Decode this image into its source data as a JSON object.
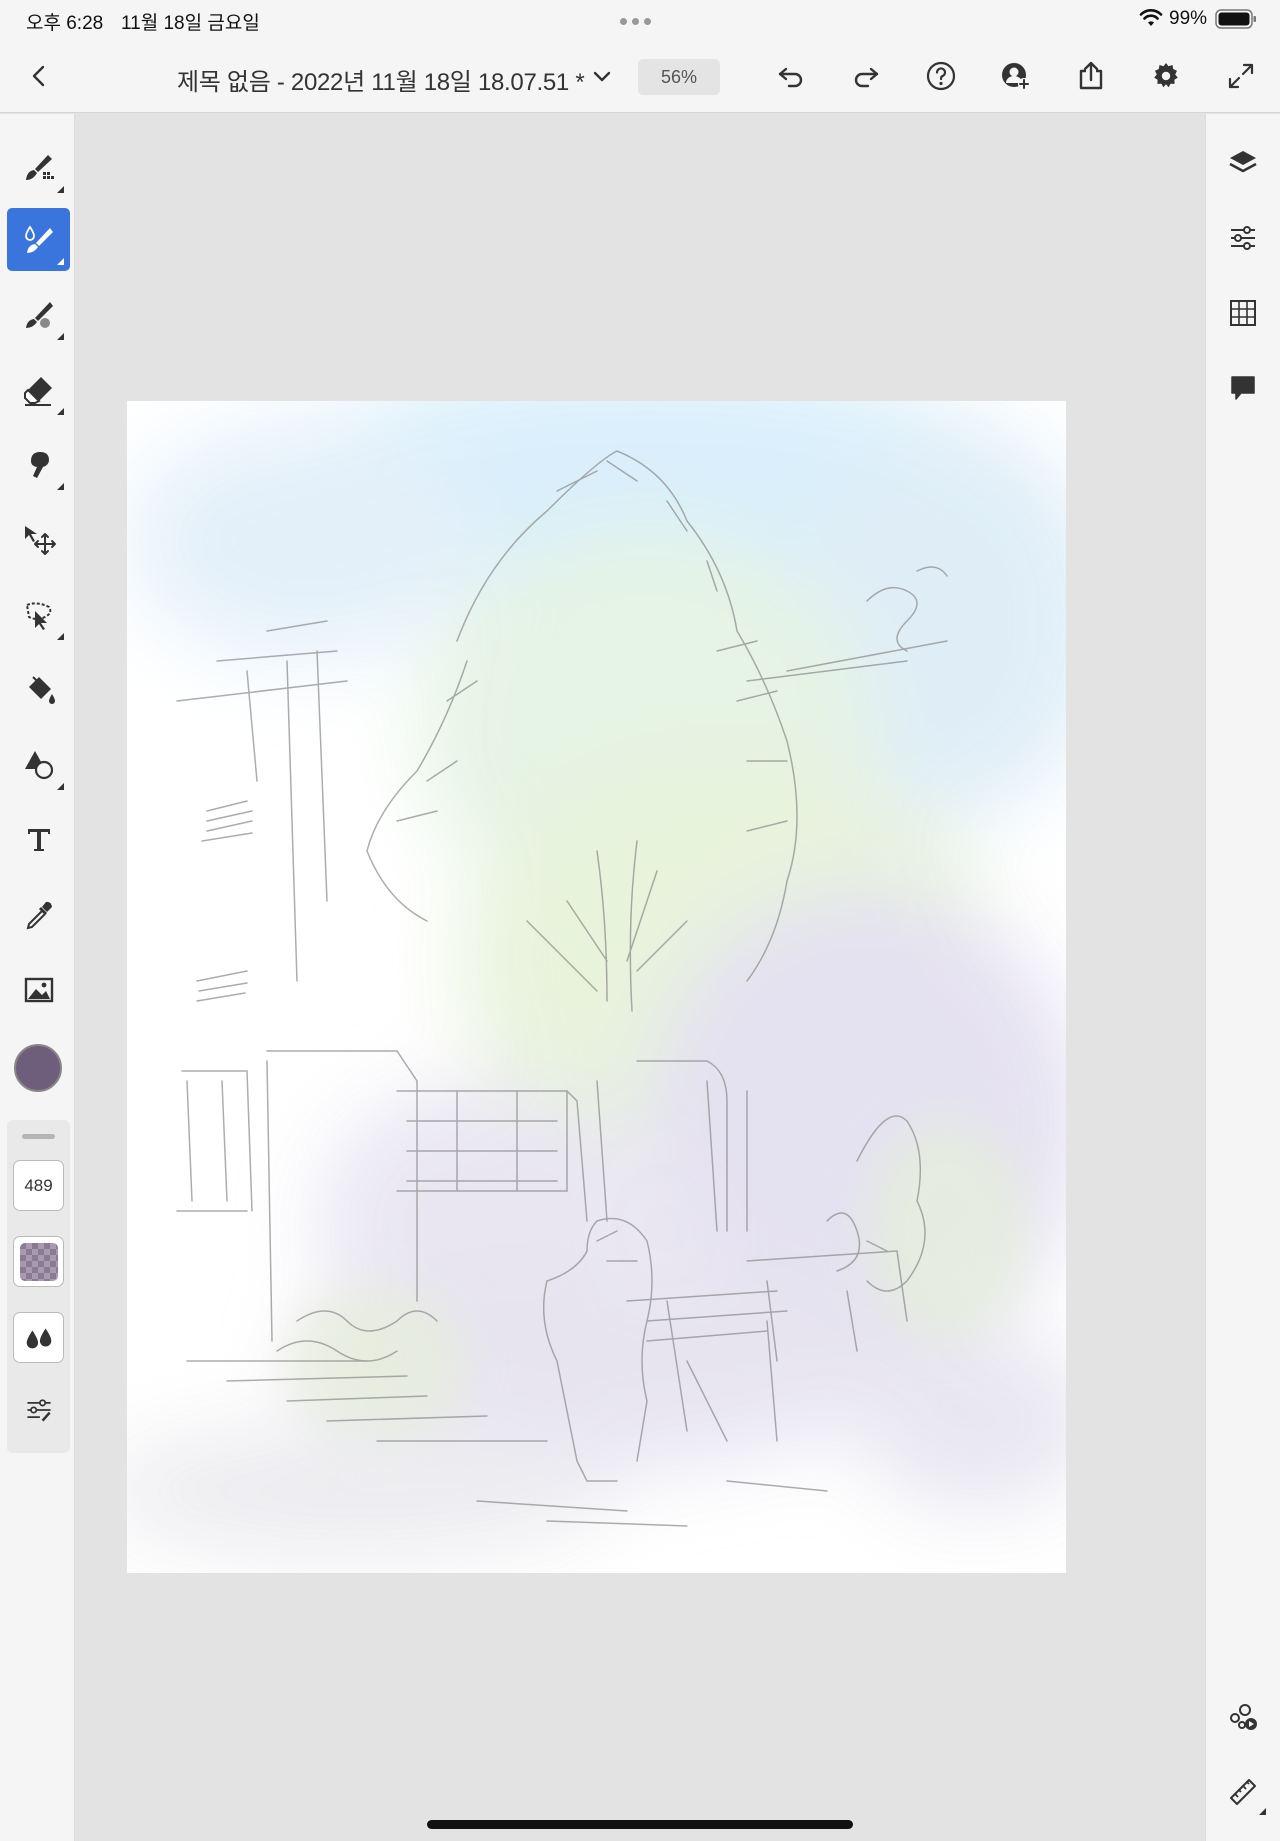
{
  "status_bar": {
    "time": "오후 6:28",
    "date": "11월 18일 금요일",
    "battery": "99%"
  },
  "toolbar": {
    "back_icon": "chevron-left-icon",
    "document_title": "제목 없음 - 2022년 11월 18일 18.07.51 *",
    "zoom": "56%",
    "actions": [
      "undo-icon",
      "redo-icon",
      "help-icon",
      "invite-icon",
      "share-icon",
      "settings-icon",
      "fullscreen-icon"
    ]
  },
  "tools": [
    {
      "name": "pixel-brush-icon",
      "active": false
    },
    {
      "name": "live-brush-icon",
      "active": true
    },
    {
      "name": "vector-brush-icon",
      "active": false
    },
    {
      "name": "eraser-icon",
      "active": false
    },
    {
      "name": "smudge-icon",
      "active": false
    },
    {
      "name": "transform-icon",
      "active": false
    },
    {
      "name": "selection-icon",
      "active": false
    },
    {
      "name": "fill-icon",
      "active": false
    },
    {
      "name": "shapes-icon",
      "active": false
    },
    {
      "name": "text-icon",
      "active": false
    },
    {
      "name": "eyedropper-icon",
      "active": false
    },
    {
      "name": "image-icon",
      "active": false
    }
  ],
  "brush": {
    "color": "#6f5d7c",
    "size": "489"
  },
  "right_panel": [
    "layers-icon",
    "layer-properties-icon",
    "grid-icon",
    "comments-icon",
    "livestream-icon",
    "ruler-icon"
  ],
  "colors": {
    "accent": "#3a75dd",
    "chrome": "#f5f5f5",
    "workspace": "#e3e3e3"
  }
}
